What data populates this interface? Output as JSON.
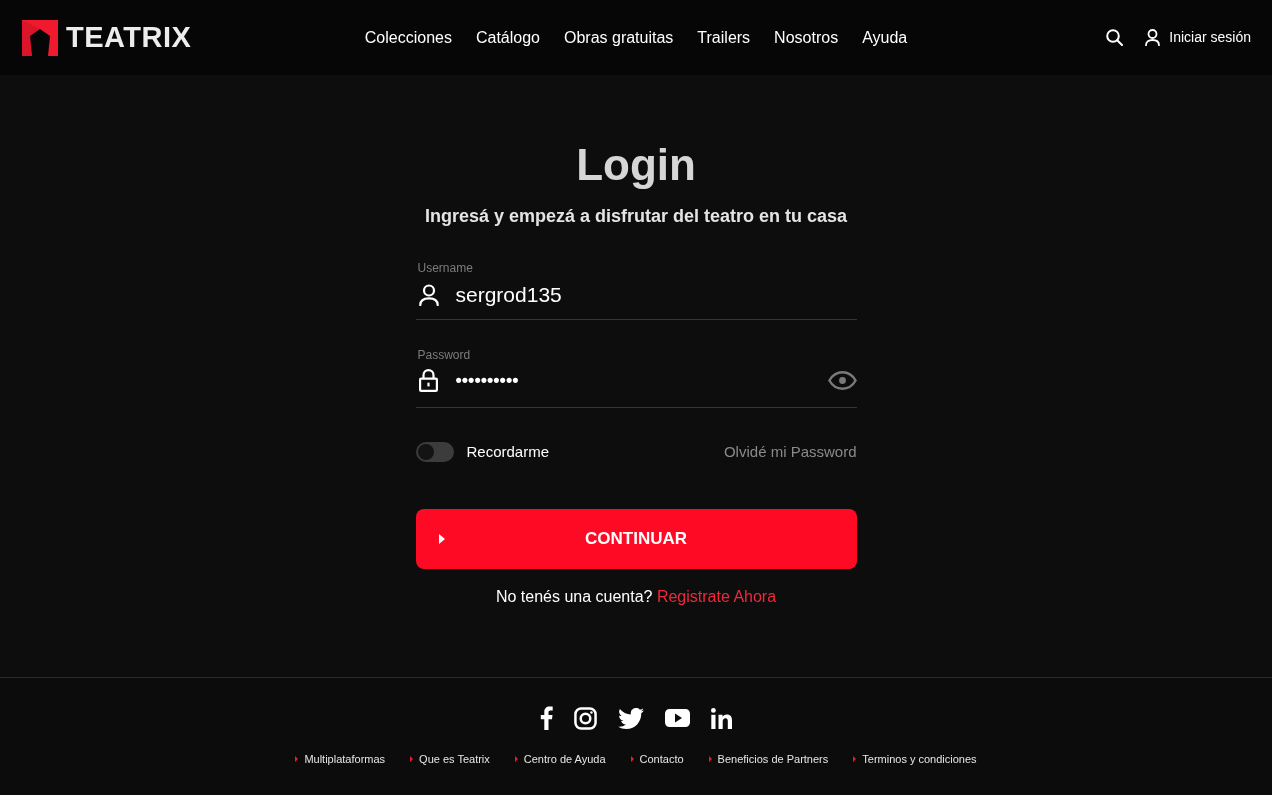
{
  "header": {
    "logo": "TEATRIX",
    "nav": [
      "Colecciones",
      "Catálogo",
      "Obras gratuitas",
      "Trailers",
      "Nosotros",
      "Ayuda"
    ],
    "sign_in": "Iniciar sesión"
  },
  "login": {
    "title": "Login",
    "subtitle": "Ingresá y empezá a disfrutar del teatro en tu casa",
    "fields": [
      {
        "kind": "text",
        "label": "Username",
        "value": "sergrod135"
      },
      {
        "kind": "password",
        "label": "Password",
        "value": "••••••••••"
      }
    ],
    "remember": {
      "label": "Recordarme",
      "on": false
    },
    "forgot": "Olvidé mi Password",
    "submit": "CONTINUAR",
    "register": {
      "text": "No tenés una cuenta?",
      "link": "Registrate Ahora"
    }
  },
  "footer": {
    "links": [
      "Multiplataformas",
      "Que es Teatrix",
      "Centro de Ayuda",
      "Contacto",
      "Beneficios de Partners",
      "Terminos y condiciones"
    ]
  }
}
